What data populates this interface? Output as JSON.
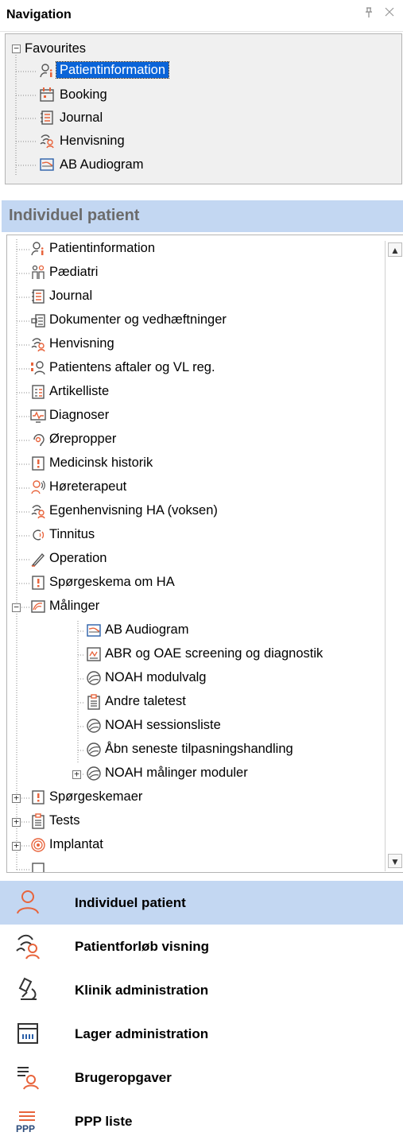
{
  "header": {
    "title": "Navigation",
    "pin_glyph": "ё",
    "close_glyph": "✕"
  },
  "favourites": {
    "root_label": "Favourites",
    "items": [
      {
        "label": "Patientinformation",
        "icon": "person-info-icon",
        "selected": true
      },
      {
        "label": "Booking",
        "icon": "calendar-icon"
      },
      {
        "label": "Journal",
        "icon": "journal-icon"
      },
      {
        "label": "Henvisning",
        "icon": "referral-icon"
      },
      {
        "label": "AB Audiogram",
        "icon": "audiogram-icon"
      }
    ]
  },
  "section": {
    "title": "Individuel patient"
  },
  "tree": {
    "items": [
      {
        "label": "Patientinformation",
        "icon": "person-info-icon"
      },
      {
        "label": "Pædiatri",
        "icon": "pediatrics-icon"
      },
      {
        "label": "Journal",
        "icon": "journal-icon"
      },
      {
        "label": "Dokumenter og vedhæftninger",
        "icon": "documents-icon"
      },
      {
        "label": "Henvisning",
        "icon": "referral-icon"
      },
      {
        "label": "Patientens aftaler og VL reg.",
        "icon": "appointments-icon"
      },
      {
        "label": "Artikelliste",
        "icon": "article-list-icon"
      },
      {
        "label": "Diagnoser",
        "icon": "diagnosis-icon"
      },
      {
        "label": "Ørepropper",
        "icon": "earplug-icon"
      },
      {
        "label": "Medicinsk historik",
        "icon": "medical-history-icon"
      },
      {
        "label": "Høreterapeut",
        "icon": "hearing-therapist-icon"
      },
      {
        "label": "Egenhenvisning HA (voksen)",
        "icon": "self-referral-icon"
      },
      {
        "label": "Tinnitus",
        "icon": "tinnitus-icon"
      },
      {
        "label": "Operation",
        "icon": "scalpel-icon"
      },
      {
        "label": "Spørgeskema om HA",
        "icon": "questionnaire-icon"
      },
      {
        "label": "Målinger",
        "icon": "measurements-icon",
        "expanded": true
      },
      {
        "label": "AB Audiogram",
        "icon": "audiogram-icon",
        "child": true
      },
      {
        "label": "ABR og OAE screening og diagnostik",
        "icon": "abr-oae-icon",
        "child": true
      },
      {
        "label": "NOAH modulvalg",
        "icon": "noah-icon",
        "child": true
      },
      {
        "label": "Andre taletest",
        "icon": "clipboard-icon",
        "child": true
      },
      {
        "label": "NOAH sessionsliste",
        "icon": "noah-icon",
        "child": true
      },
      {
        "label": "Åbn seneste tilpasningshandling",
        "icon": "noah-icon",
        "child": true
      },
      {
        "label": "NOAH målinger moduler",
        "icon": "noah-icon",
        "child": true,
        "collapsed": true
      },
      {
        "label": "Spørgeskemaer",
        "icon": "questionnaire-icon",
        "collapsed": true
      },
      {
        "label": "Tests",
        "icon": "clipboard-icon",
        "collapsed": true
      },
      {
        "label": "Implantat",
        "icon": "implant-icon",
        "collapsed": true
      }
    ]
  },
  "bottom_nav": [
    {
      "label": "Individuel patient",
      "icon": "person-icon",
      "active": true
    },
    {
      "label": "Patientforløb visning",
      "icon": "patient-flow-icon"
    },
    {
      "label": "Klinik administration",
      "icon": "microscope-icon"
    },
    {
      "label": "Lager administration",
      "icon": "warehouse-icon"
    },
    {
      "label": "Brugeropgaver",
      "icon": "user-tasks-icon"
    },
    {
      "label": "PPP liste",
      "icon": "ppp-list-icon",
      "icon_text": "PPP"
    }
  ],
  "colors": {
    "accent": "#e8643c",
    "selection": "#0a64d8",
    "active_bg": "#c3d7f2",
    "icon_blue": "#2a5fa8"
  }
}
